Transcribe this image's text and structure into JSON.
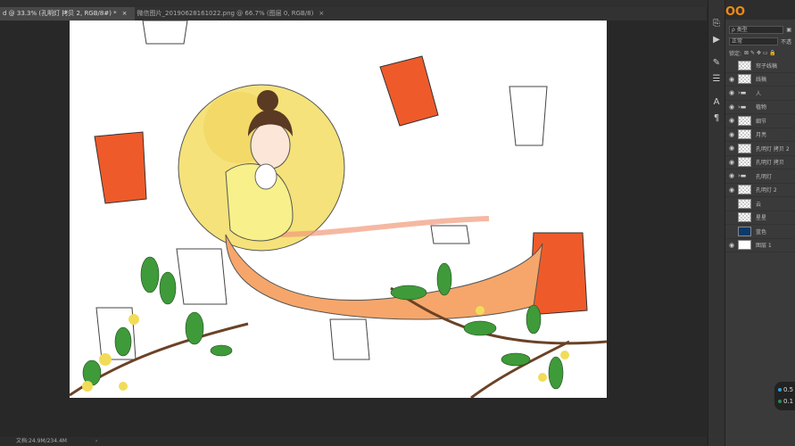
{
  "tabs": [
    {
      "label": "d @ 33.3% (孔明灯 拷贝 2, RGB/8#) *",
      "active": true
    },
    {
      "label": "微信图片_20190628161022.png @ 66.7% (图层 0, RGB/8)",
      "active": false
    }
  ],
  "tab_close": "×",
  "status": {
    "doc_size": "文档:24.9M/234.4M",
    "arrow": "›"
  },
  "logo": "OO",
  "layers_panel": {
    "filter_label": "ρ 类型",
    "blend_mode": "正常",
    "opacity_label": "不透",
    "lock_label": "锁定:",
    "layers": [
      {
        "name": "帘子线稿",
        "visible": false,
        "type": "layer"
      },
      {
        "name": "线稿",
        "visible": true,
        "type": "layer"
      },
      {
        "name": "人",
        "visible": true,
        "type": "group"
      },
      {
        "name": "植物",
        "visible": true,
        "type": "group"
      },
      {
        "name": "细节",
        "visible": true,
        "type": "layer"
      },
      {
        "name": "月亮",
        "visible": true,
        "type": "layer"
      },
      {
        "name": "孔明灯 拷贝 2",
        "visible": true,
        "type": "layer"
      },
      {
        "name": "孔明灯 拷贝",
        "visible": true,
        "type": "layer"
      },
      {
        "name": "孔明灯",
        "visible": true,
        "type": "group"
      },
      {
        "name": "孔明灯 2",
        "visible": true,
        "type": "layer"
      },
      {
        "name": "云",
        "visible": false,
        "type": "layer"
      },
      {
        "name": "星星",
        "visible": false,
        "type": "layer"
      },
      {
        "name": "蓝色",
        "visible": false,
        "type": "layer",
        "fill": "#0d3a6b"
      },
      {
        "name": "图层 1",
        "visible": true,
        "type": "layer",
        "fill": "#ffffff"
      }
    ]
  },
  "mini_widget": [
    "0.5",
    "0.1"
  ],
  "colors": {
    "accent": "#f08a14",
    "moon": "#f5e27a",
    "lantern": "#ef5a2a",
    "robe": "#f6a66a"
  }
}
